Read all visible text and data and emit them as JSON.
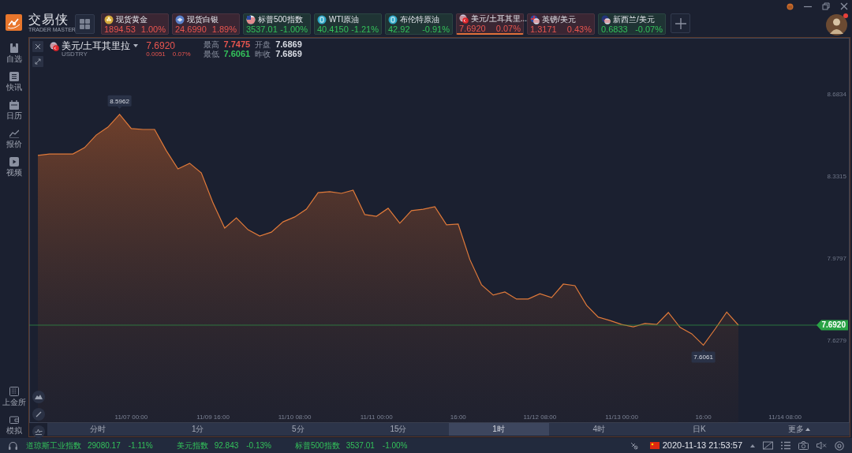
{
  "app": {
    "logo_text": "交易侠",
    "logo_subtitle": "TRADER MASTER"
  },
  "tickers": [
    {
      "name": "现货黄金",
      "price": "1894.53",
      "change": "1.00%",
      "color": "#e8554f",
      "selected": false
    },
    {
      "name": "现货白银",
      "price": "24.6990",
      "change": "1.89%",
      "color": "#e8554f",
      "selected": false
    },
    {
      "name": "标普500指数",
      "price": "3537.01",
      "change": "-1.00%",
      "color": "#33c15a",
      "selected": false
    },
    {
      "name": "WTI原油",
      "price": "40.4150",
      "change": "-1.21%",
      "color": "#33c15a",
      "selected": false
    },
    {
      "name": "布伦特原油",
      "price": "42.92",
      "change": "-0.91%",
      "color": "#33c15a",
      "selected": false
    },
    {
      "name": "美元/土耳其里...",
      "price": "7.6920",
      "change": "0.07%",
      "color": "#e8554f",
      "selected": true
    },
    {
      "name": "英镑/美元",
      "price": "1.3171",
      "change": "0.43%",
      "color": "#e8554f",
      "selected": false
    },
    {
      "name": "新西兰/美元",
      "price": "0.6833",
      "change": "-0.07%",
      "color": "#33c15a",
      "selected": false
    }
  ],
  "sidebar": {
    "top": [
      {
        "label": "自选"
      },
      {
        "label": "快讯"
      },
      {
        "label": "日历"
      },
      {
        "label": "报价"
      },
      {
        "label": "视频"
      }
    ],
    "bottom": [
      {
        "label": "上金所"
      },
      {
        "label": "模拟"
      }
    ]
  },
  "instrument": {
    "name": "美元/土耳其里拉",
    "code": "USDTRY",
    "price": "7.6920",
    "change": "0.0051",
    "change_pct": "0.07%",
    "color": "#e8554f",
    "stats": [
      {
        "label": "最高",
        "value": "7.7475",
        "color": "#e8554f"
      },
      {
        "label": "开盘",
        "value": "7.6869",
        "color": "#d8dbe3"
      },
      {
        "label": "最低",
        "value": "7.6061",
        "color": "#33c15a"
      },
      {
        "label": "昨收",
        "value": "7.6869",
        "color": "#d8dbe3"
      }
    ]
  },
  "chart": {
    "chart_data": {
      "type": "area",
      "categories": [
        null,
        null,
        null,
        null,
        null,
        null,
        null,
        null,
        "11/07 00:00",
        null,
        null,
        null,
        null,
        null,
        null,
        "11/09 16:00",
        null,
        null,
        null,
        null,
        null,
        null,
        "11/10 08:00",
        null,
        null,
        null,
        null,
        null,
        null,
        "11/11 00:00",
        null,
        null,
        null,
        null,
        null,
        null,
        "16:00",
        null,
        null,
        null,
        null,
        null,
        null,
        "11/12 08:00",
        null,
        null,
        null,
        null,
        null,
        null,
        "11/13 00:00",
        null,
        null,
        null,
        null,
        null,
        null,
        "16:00",
        null,
        null,
        null,
        null,
        null,
        null,
        "11/14 08:00"
      ],
      "series": [
        {
          "color": "#e07a3a",
          "values": [
            8.42,
            8.426,
            8.426,
            8.426,
            8.453,
            8.507,
            8.541,
            8.596,
            8.535,
            8.531,
            8.531,
            8.44,
            8.362,
            8.386,
            8.345,
            8.216,
            8.108,
            8.152,
            8.101,
            8.074,
            8.091,
            8.135,
            8.156,
            8.189,
            8.26,
            8.264,
            8.257,
            8.271,
            8.166,
            8.159,
            8.193,
            8.129,
            8.183,
            8.189,
            8.2,
            8.122,
            8.125,
            7.973,
            7.865,
            7.821,
            7.834,
            7.804,
            7.804,
            7.827,
            7.81,
            7.868,
            7.861,
            7.777,
            7.726,
            7.712,
            7.695,
            7.685,
            7.699,
            7.695,
            7.746,
            7.682,
            7.655,
            7.606,
            7.675,
            7.748,
            7.692,
            null,
            null,
            null,
            null
          ]
        }
      ],
      "ylim": [
        7.2724,
        8.9236
      ],
      "yticks": [
        8.6834,
        8.3315,
        7.9797,
        7.6279
      ],
      "ref_lines": [
        {
          "axis": "y",
          "value": 7.692,
          "label": "7.6920",
          "color": "#2f8a45"
        }
      ],
      "annotations": [
        {
          "y": 8.5962,
          "text": "8.5962"
        },
        {
          "y": 7.6061,
          "text": "7.6061"
        }
      ]
    }
  },
  "timeframes": [
    {
      "label": "分时",
      "selected": false
    },
    {
      "label": "1分",
      "selected": false
    },
    {
      "label": "5分",
      "selected": false
    },
    {
      "label": "15分",
      "selected": false
    },
    {
      "label": "1时",
      "selected": true
    },
    {
      "label": "4时",
      "selected": false
    },
    {
      "label": "日K",
      "selected": false
    },
    {
      "label": "更多",
      "selected": false
    }
  ],
  "status_bar": {
    "indices": [
      {
        "name": "道琼斯工业指数",
        "value": "29080.17",
        "change": "-1.11%"
      },
      {
        "name": "美元指数",
        "value": "92.843",
        "change": "-0.13%"
      },
      {
        "name": "标普500指数",
        "value": "3537.01",
        "change": "-1.00%"
      }
    ],
    "datetime": "2020-11-13 21:53:57"
  }
}
